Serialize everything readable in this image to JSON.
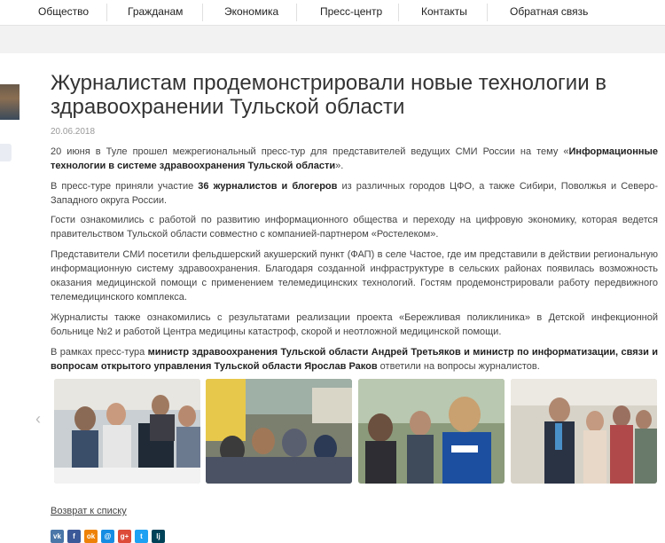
{
  "nav": {
    "items": [
      "Общество",
      "Гражданам",
      "Экономика",
      "Пресс-центр",
      "Контакты",
      "Обратная связь"
    ]
  },
  "article": {
    "title": "Журналистам продемонстрировали новые технологии в здравоохранении Тульской области",
    "date": "20.06.2018",
    "p1": {
      "a": "20 июня в Туле прошел межрегиональный пресс-тур для представителей ведущих СМИ России на тему «",
      "b": "Информационные технологии в системе здравоохранения Тульской области",
      "c": "»."
    },
    "p2": {
      "a": "В пресс-туре приняли участие ",
      "b": "36 журналистов и блогеров",
      "c": " из различных городов ЦФО, а также Сибири, Поволжья и Северо-Западного округа России."
    },
    "p3": "Гости ознакомились с работой по развитию информационного общества и переходу на цифровую экономику, которая ведется правительством Тульской области совместно с компанией-партнером «Ростелеком».",
    "p4": "Представители СМИ посетили фельдшерский акушерский пункт (ФАП) в селе Частое, где им представили в действии региональную информационную систему здравоохранения. Благодаря созданной инфраструктуре в сельских районах появилась возможность оказания медицинской помощи с применением телемедицинских технологий. Гостям продемонстрировали работу передвижного телемедицинского комплекса.",
    "p5": "Журналисты также ознакомились с результатами реализации проекта «Бережливая поликлиника» в Детской инфекционной больнице №2 и работой Центра медицины катастроф, скорой и неотложной медицинской помощи.",
    "p6": {
      "a": "В рамках пресс-тура ",
      "b": "министр здравоохранения Тульской области Андрей Третьяков и министр по информатизации, связи и вопросам открытого управления Тульской области Ярослав Раков",
      "c": " ответили на вопросы журналистов."
    }
  },
  "gallery": {
    "prev_arrow": "‹",
    "photos": [
      "photo-1",
      "photo-2",
      "photo-3",
      "photo-4"
    ]
  },
  "back_link": "Возврат к списку",
  "share": {
    "icons": [
      {
        "name": "vk-icon",
        "glyph": "vk",
        "color": "#4a76a8"
      },
      {
        "name": "facebook-icon",
        "glyph": "f",
        "color": "#3b5998"
      },
      {
        "name": "odnoklassniki-icon",
        "glyph": "ok",
        "color": "#ee8208"
      },
      {
        "name": "moimir-icon",
        "glyph": "@",
        "color": "#168de2"
      },
      {
        "name": "googleplus-icon",
        "glyph": "g+",
        "color": "#dd4b39"
      },
      {
        "name": "twitter-icon",
        "glyph": "t",
        "color": "#1da1f2"
      },
      {
        "name": "livejournal-icon",
        "glyph": "lj",
        "color": "#004359"
      }
    ]
  }
}
